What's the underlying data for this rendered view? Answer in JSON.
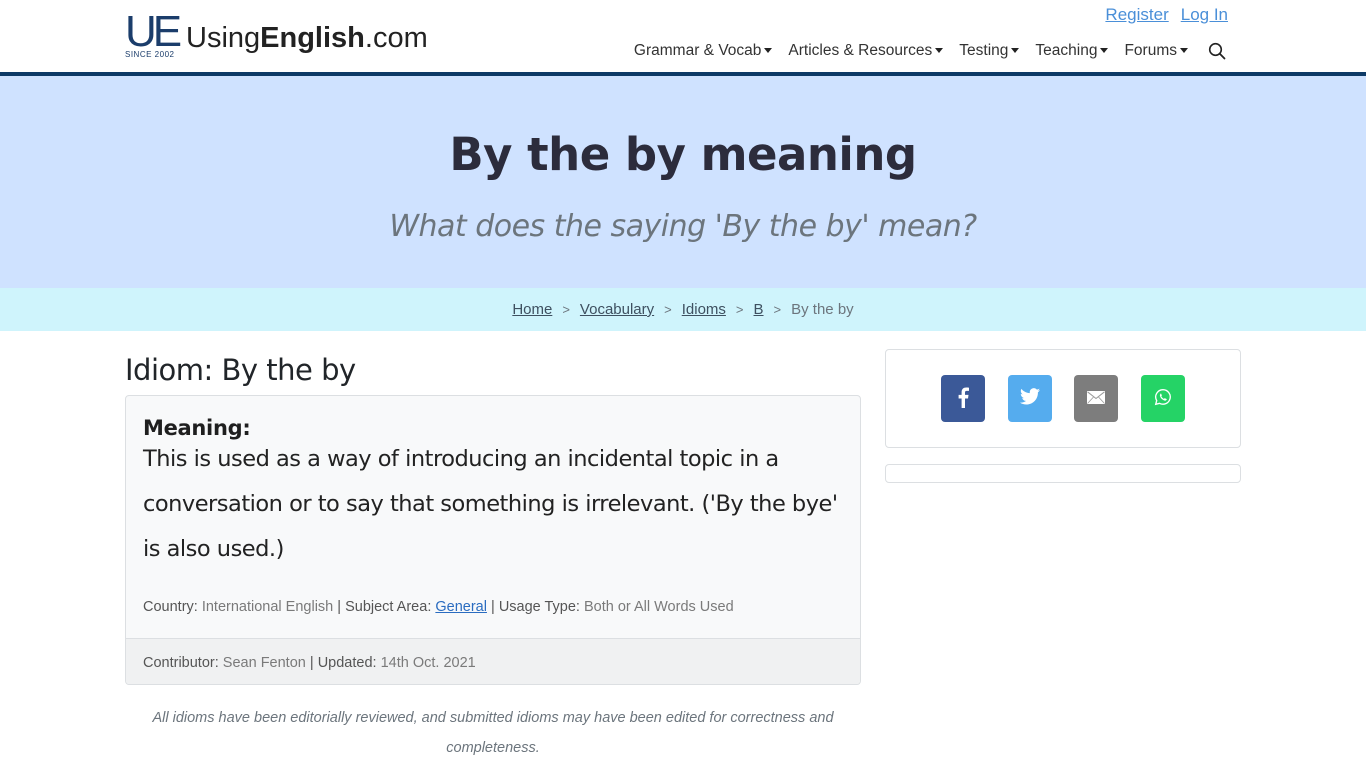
{
  "header": {
    "logo": {
      "mark": "UE",
      "since": "SINCE 2002",
      "text_pre": "Using",
      "text_bold": "English",
      "text_post": ".com"
    },
    "auth": {
      "register": "Register",
      "login": "Log In"
    },
    "nav": [
      {
        "label": "Grammar & Vocab",
        "icon": "caret-down-icon"
      },
      {
        "label": "Articles & Resources",
        "icon": "caret-down-icon"
      },
      {
        "label": "Testing",
        "icon": "caret-down-icon"
      },
      {
        "label": "Teaching",
        "icon": "caret-down-icon"
      },
      {
        "label": "Forums",
        "icon": "caret-down-icon"
      }
    ],
    "search_icon": "search-icon"
  },
  "hero": {
    "title": "By the by meaning",
    "subtitle": "What does the saying 'By the by' mean?"
  },
  "breadcrumb": {
    "items": [
      {
        "label": "Home"
      },
      {
        "label": "Vocabulary"
      },
      {
        "label": "Idioms"
      },
      {
        "label": "B"
      }
    ],
    "separator": ">",
    "current": "By the by"
  },
  "main": {
    "title": "Idiom: By the by",
    "meaning_label": "Meaning:",
    "meaning_text": "This is used as a way of introducing an incidental topic in a conversation or to say that something is irrelevant. ('By the bye' is also used.)",
    "meta": {
      "country_label": "Country:",
      "country": "International English",
      "subject_label": "Subject Area:",
      "subject": "General",
      "usage_label": "Usage Type:",
      "usage": "Both or All Words Used",
      "divider": "|"
    },
    "footer": {
      "contributor_label": "Contributor:",
      "contributor": "Sean Fenton",
      "updated_label": "Updated:",
      "updated": "14th Oct. 2021",
      "divider": "|"
    },
    "note": "All idioms have been editorially reviewed, and submitted idioms may have been edited for correctness and completeness."
  },
  "sidebar": {
    "share": [
      {
        "name": "facebook",
        "icon": "facebook-icon",
        "color": "#3b5998"
      },
      {
        "name": "twitter",
        "icon": "twitter-icon",
        "color": "#55acee"
      },
      {
        "name": "email",
        "icon": "email-icon",
        "color": "#7d7d7d"
      },
      {
        "name": "whatsapp",
        "icon": "whatsapp-icon",
        "color": "#25d366"
      }
    ]
  },
  "colors": {
    "header_rule": "#0d3a66",
    "hero_bg": "#cfe2ff",
    "breadcrumb_bg": "#cff4fc",
    "link": "#4a8fd8"
  }
}
